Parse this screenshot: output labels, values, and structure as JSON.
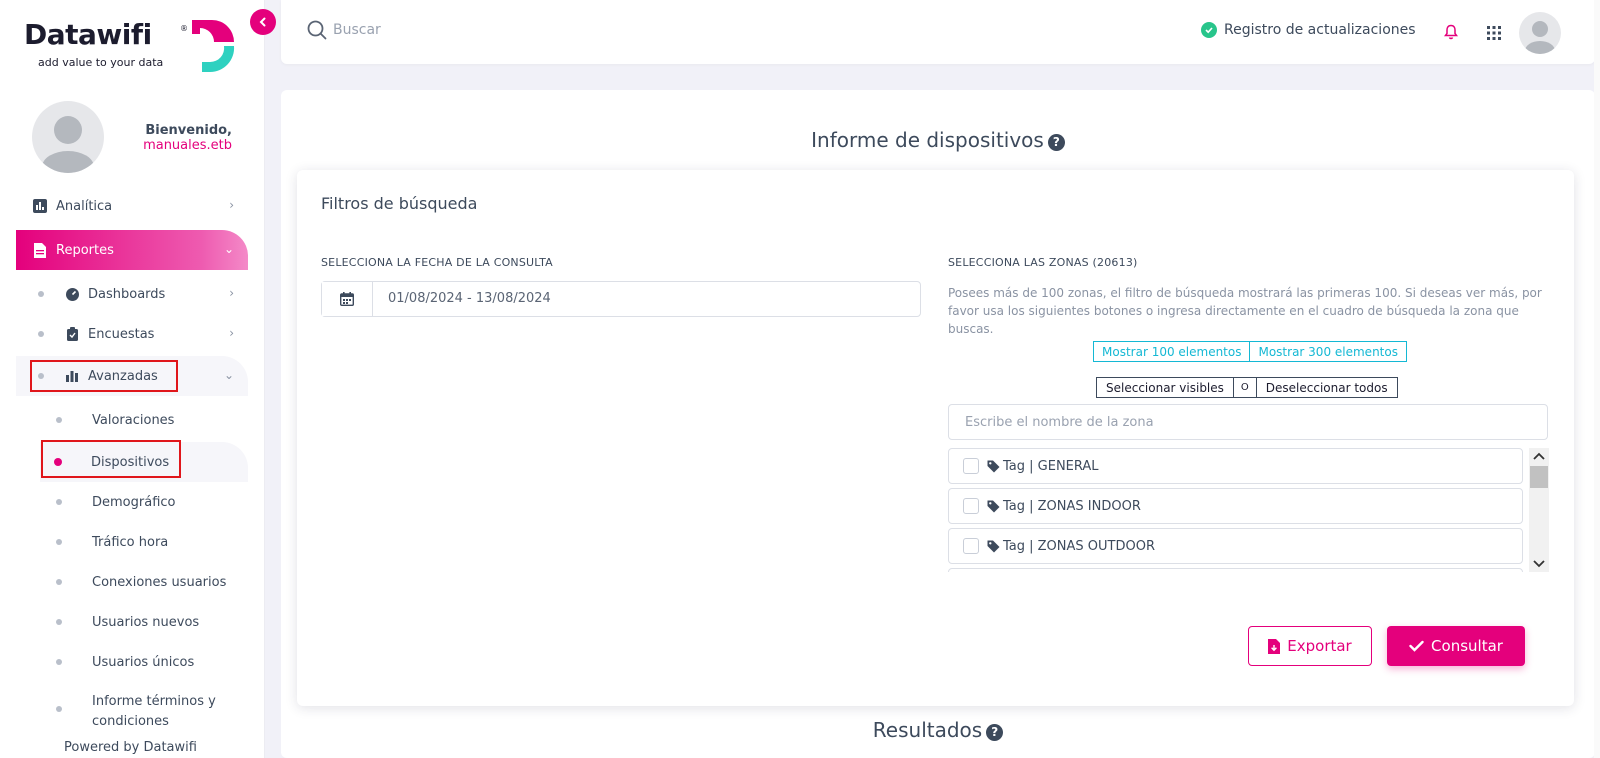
{
  "brand": {
    "name": "Datawifi",
    "registered": "®",
    "tagline": "add value to your data",
    "colors": {
      "primary": "#e4007c",
      "teal": "#2ed1c0",
      "dark": "#1c1c2e",
      "text": "#3d4a5c"
    }
  },
  "sidebar": {
    "collapse_icon": "chevron-left-icon",
    "welcome": "Bienvenido,",
    "username": "manuales.etb",
    "items": [
      {
        "label": "Analítica",
        "icon": "bar-chart-icon",
        "chevron": "›"
      },
      {
        "label": "Reportes",
        "icon": "document-icon",
        "chevron": "⌄"
      }
    ],
    "sub_items": [
      {
        "label": "Dashboards",
        "icon": "gauge-icon",
        "chevron": "›"
      },
      {
        "label": "Encuestas",
        "icon": "clipboard-icon",
        "chevron": "›"
      },
      {
        "label": "Avanzadas",
        "icon": "bars-icon",
        "chevron": "⌄"
      }
    ],
    "advanced_items": [
      "Valoraciones",
      "Dispositivos",
      "Demográfico",
      "Tráfico hora",
      "Conexiones usuarios",
      "Usuarios nuevos",
      "Usuarios únicos",
      "Informe términos y condiciones"
    ],
    "powered_by": "Powered by Datawifi"
  },
  "topbar": {
    "search_placeholder": "Buscar",
    "updates_label": "Registro de actualizaciones"
  },
  "main": {
    "title": "Informe de dispositivos",
    "filters_title": "Filtros de búsqueda",
    "date_label": "SELECCIONA LA FECHA DE LA CONSULTA",
    "date_value": "01/08/2024 - 13/08/2024",
    "zones_label": "SELECCIONA LAS ZONAS (20613)",
    "zones_note": "Posees más de 100 zonas, el filtro de búsqueda mostrará las primeras 100. Si deseas ver más, por favor usa los siguientes botones o ingresa directamente en el cuadro de búsqueda la zona que buscas.",
    "show_100": "Mostrar 100 elementos",
    "show_300": "Mostrar 300 elementos",
    "select_visible": "Seleccionar visibles",
    "mid_symbol": "O",
    "deselect_all": "Deseleccionar todos",
    "zone_search_placeholder": "Escribe el nombre de la zona",
    "zones": [
      "Tag | GENERAL",
      "Tag | ZONAS INDOOR",
      "Tag | ZONAS OUTDOOR"
    ],
    "export_label": "Exportar",
    "consult_label": "Consultar",
    "results_title": "Resultados"
  }
}
